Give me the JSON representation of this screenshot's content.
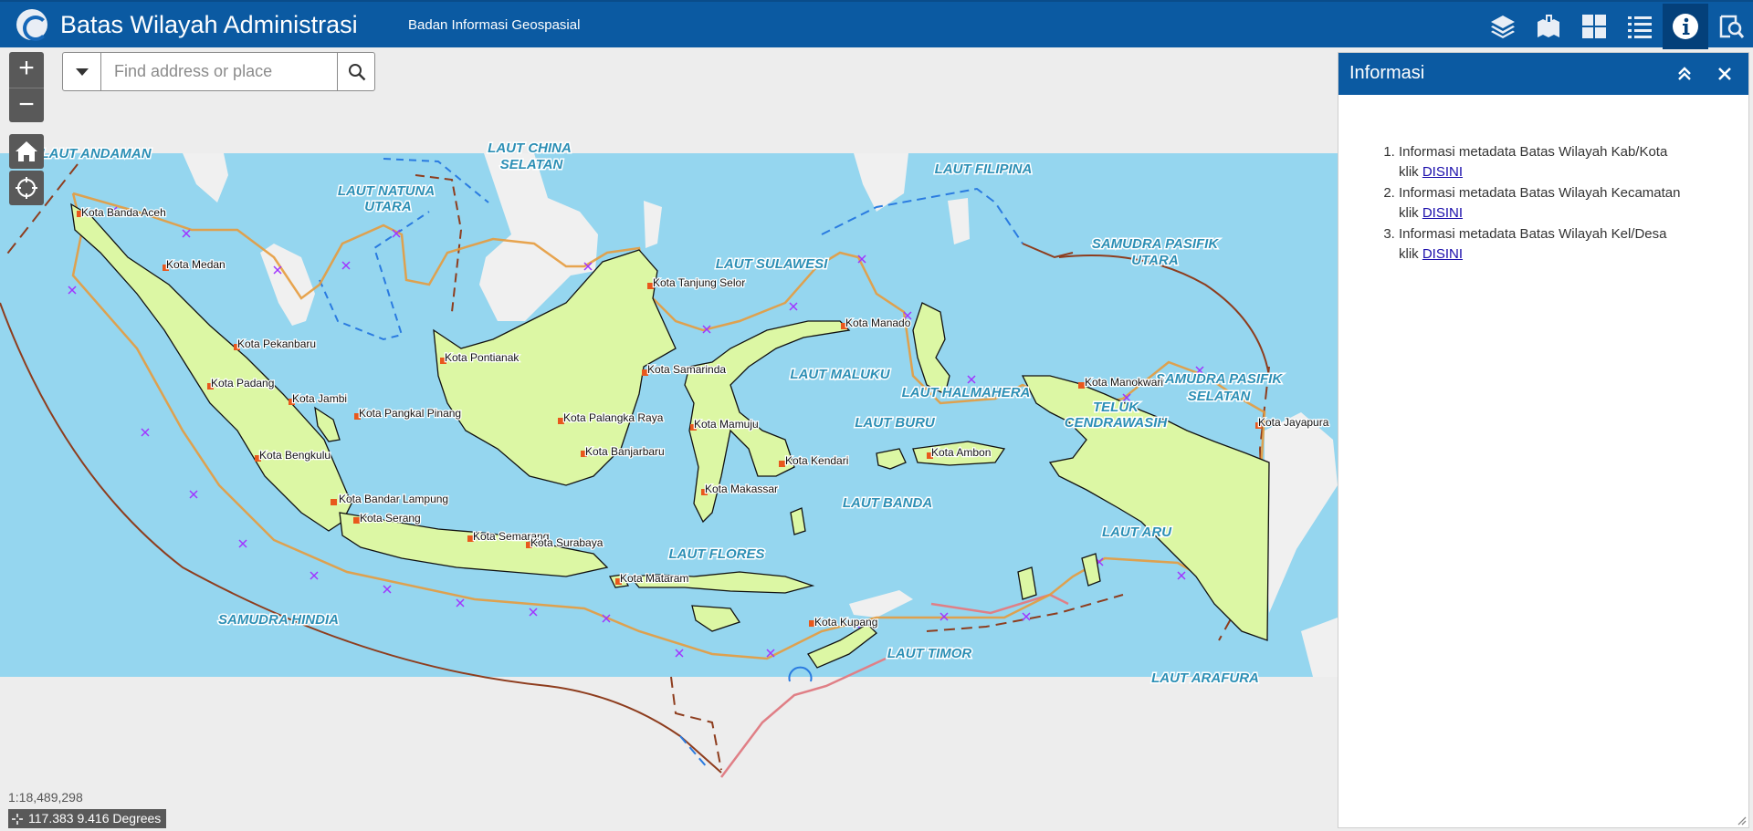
{
  "header": {
    "title": "Batas Wilayah Administrasi",
    "subtitle": "Badan Informasi Geospasial",
    "buttons": [
      {
        "name": "layer-list-button",
        "icon": "layers-icon"
      },
      {
        "name": "legend-button",
        "icon": "legend-icon"
      },
      {
        "name": "basemap-gallery-button",
        "icon": "grid-icon"
      },
      {
        "name": "list-button",
        "icon": "list-icon"
      },
      {
        "name": "about-button",
        "icon": "info-icon",
        "active": true
      },
      {
        "name": "query-button",
        "icon": "query-icon"
      }
    ],
    "colors": {
      "bar": "#0b5aa2",
      "active": "#04407a"
    }
  },
  "search": {
    "placeholder": "Find address or place",
    "value": ""
  },
  "map": {
    "sea_labels": [
      {
        "text": "LAUT ANDAMAN"
      },
      {
        "text": "LAUT CHINA"
      },
      {
        "text": "SELATAN"
      },
      {
        "text": "LAUT NATUNA"
      },
      {
        "text": "UTARA"
      },
      {
        "text": "LAUT FILIPINA"
      },
      {
        "text": "SAMUDRA PASIFIK"
      },
      {
        "text": "UTARA"
      },
      {
        "text": "LAUT SULAWESI"
      },
      {
        "text": "LAUT MALUKU"
      },
      {
        "text": "LAUT HALMAHERA"
      },
      {
        "text": "SAMUDRA PASIFIK"
      },
      {
        "text": "SELATAN"
      },
      {
        "text": "TELUK"
      },
      {
        "text": "CENDRAWASIH"
      },
      {
        "text": "LAUT BURU"
      },
      {
        "text": "LAUT BANDA"
      },
      {
        "text": "LAUT ARU"
      },
      {
        "text": "LAUT FLORES"
      },
      {
        "text": "SAMUDRA HINDIA"
      },
      {
        "text": "LAUT TIMOR"
      },
      {
        "text": "LAUT ARAFURA"
      }
    ],
    "cities": [
      "Kota Banda Aceh",
      "Kota Medan",
      "Kota Pekanbaru",
      "Kota Padang",
      "Kota Jambi",
      "Kota Pangkal Pinang",
      "Kota Bengkulu",
      "Kota Bandar Lampung",
      "Kota Serang",
      "Kota Semarang",
      "Kota Surabaya",
      "Kota Mataram",
      "Kota Kupang",
      "Kota Pontianak",
      "Kota Palangka Raya",
      "Kota Banjarbaru",
      "Kota Samarinda",
      "Kota Tanjung Selor",
      "Kota Mamuju",
      "Kota Makassar",
      "Kota Kendari",
      "Kota Manado",
      "Kota Ambon",
      "Kota Manokwari",
      "Kota Jayapura"
    ],
    "scale": "1:18,489,298",
    "coordinates": "117.383 9.416 Degrees",
    "colors": {
      "sea": "#95d6ef",
      "land": "#dcf7a4",
      "outside": "#ededed",
      "neighbor": "#f0f0f0"
    }
  },
  "panel": {
    "title": "Informasi",
    "items": [
      {
        "text": "Informasi metadata Batas Wilayah Kab/Kota",
        "prefix": "klik",
        "link": "DISINI"
      },
      {
        "text": "Informasi metadata Batas Wilayah Kecamatan",
        "prefix": "klik",
        "link": "DISINI"
      },
      {
        "text": "Informasi metadata Batas Wilayah Kel/Desa",
        "prefix": "klik",
        "link": "DISINI"
      }
    ]
  }
}
